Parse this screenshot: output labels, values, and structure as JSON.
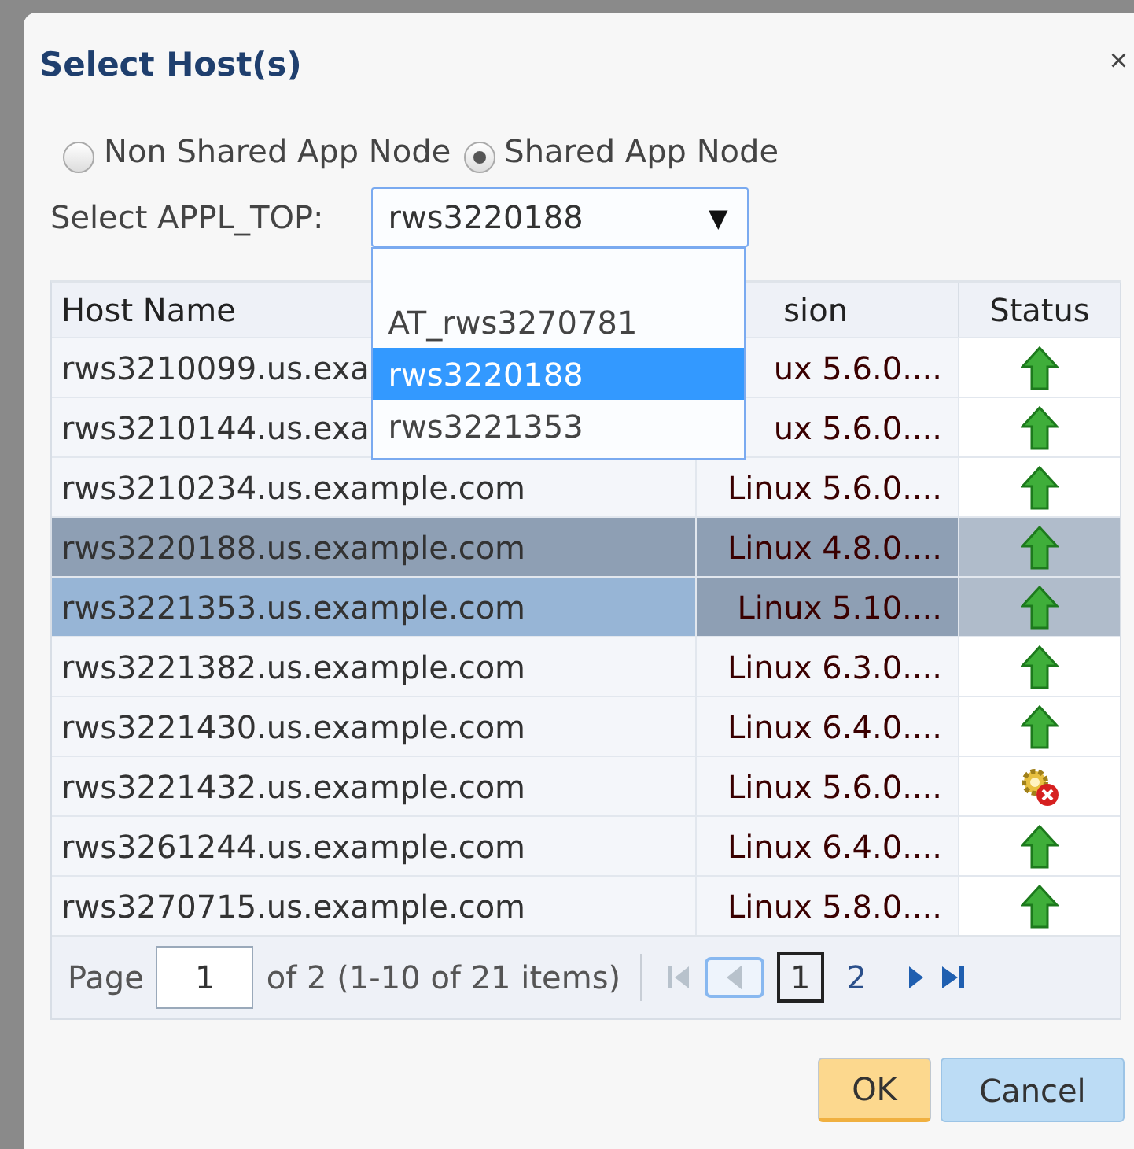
{
  "dialog": {
    "title": "Select Host(s)",
    "close": "×"
  },
  "node_type": [
    {
      "label": "Non Shared App Node",
      "selected": false
    },
    {
      "label": "Shared App Node",
      "selected": true
    }
  ],
  "appl_top": {
    "label": "Select APPL_TOP:",
    "value": "rws3220188",
    "arrow": "▼",
    "expanded": true,
    "options": [
      {
        "label": "AT_rws3270781",
        "selected": false
      },
      {
        "label": "rws3220188",
        "selected": true
      },
      {
        "label": "rws3221353",
        "selected": false
      }
    ]
  },
  "table": {
    "columns": [
      "Host Name",
      "sion",
      "Status"
    ],
    "rows": [
      {
        "host": "rws3210099.us.exa",
        "version": "ux 5.6.0....",
        "kind": "up",
        "selected": false,
        "hovered": false
      },
      {
        "host": "rws3210144.us.exa",
        "version": "ux 5.6.0....",
        "kind": "up",
        "selected": false,
        "hovered": false
      },
      {
        "host": "rws3210234.us.example.com",
        "version": "Linux 5.6.0....",
        "kind": "up",
        "selected": false,
        "hovered": false
      },
      {
        "host": "rws3220188.us.example.com",
        "version": "Linux 4.8.0....",
        "kind": "up",
        "selected": true,
        "hovered": false
      },
      {
        "host": "rws3221353.us.example.com",
        "version": "Linux 5.10....",
        "kind": "up",
        "selected": false,
        "hovered": true
      },
      {
        "host": "rws3221382.us.example.com",
        "version": "Linux 6.3.0....",
        "kind": "up",
        "selected": false,
        "hovered": false
      },
      {
        "host": "rws3221430.us.example.com",
        "version": "Linux 6.4.0....",
        "kind": "up",
        "selected": false,
        "hovered": false
      },
      {
        "host": "rws3221432.us.example.com",
        "version": "Linux 5.6.0....",
        "kind": "error",
        "selected": false,
        "hovered": false
      },
      {
        "host": "rws3261244.us.example.com",
        "version": "Linux 6.4.0....",
        "kind": "up",
        "selected": false,
        "hovered": false
      },
      {
        "host": "rws3270715.us.example.com",
        "version": "Linux 5.8.0....",
        "kind": "up",
        "selected": false,
        "hovered": false
      }
    ]
  },
  "pager": {
    "label": "Page",
    "page": "1",
    "summary": "of 2 (1-10 of 21 items)",
    "pages": [
      {
        "label": "1",
        "selected": true
      },
      {
        "label": "2",
        "selected": false
      }
    ]
  },
  "buttons": [
    "OK",
    "Cancel"
  ]
}
